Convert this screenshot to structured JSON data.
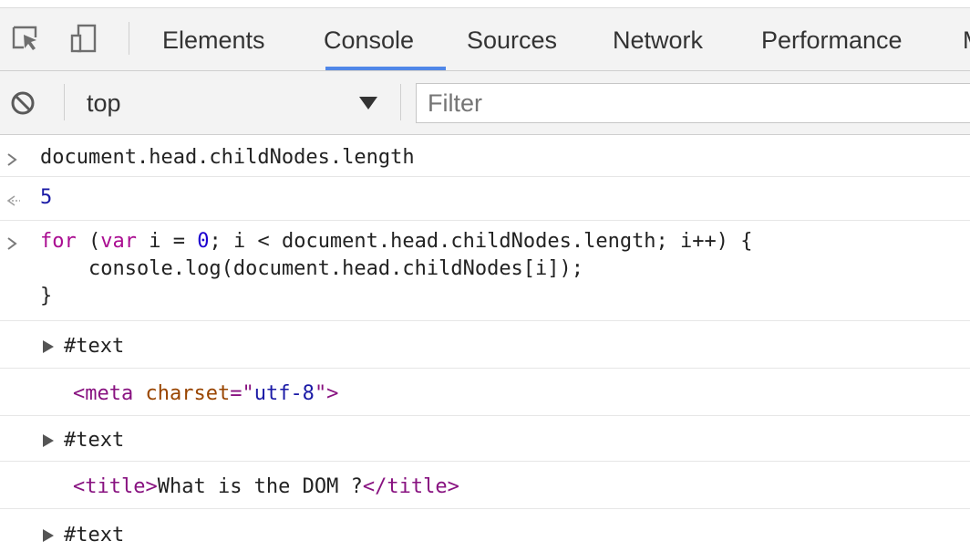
{
  "tabs": {
    "items": [
      {
        "label": "Elements"
      },
      {
        "label": "Console"
      },
      {
        "label": "Sources"
      },
      {
        "label": "Network"
      },
      {
        "label": "Performance"
      }
    ],
    "overflow_glyph": "M"
  },
  "filterbar": {
    "context": "top",
    "filter_placeholder": "Filter"
  },
  "console": {
    "input1": "document.head.childNodes.length",
    "result1": "5",
    "loop": {
      "kw_for": "for",
      "p1": " (",
      "kw_var": "var",
      "p2": " i = ",
      "zero": "0",
      "p3": "; i < document.head.childNodes.length; i++) {",
      "line2": "    console.log(document.head.childNodes[i]);",
      "line3": "}"
    },
    "outputs": {
      "text1": "#text",
      "meta_open": "<meta",
      "meta_attr": " charset",
      "meta_eq": "=\"",
      "meta_val": "utf-8",
      "meta_close": "\">",
      "text2": "#text",
      "title_open": "<title>",
      "title_content": "What is the DOM ?",
      "title_close": "</title>",
      "text3": "#text"
    }
  },
  "colors": {
    "accent": "#5087e8",
    "keyword": "#aa0d91",
    "number": "#1c00cf",
    "tag": "#881280",
    "attribute": "#994500",
    "value": "#1a1aa6"
  }
}
